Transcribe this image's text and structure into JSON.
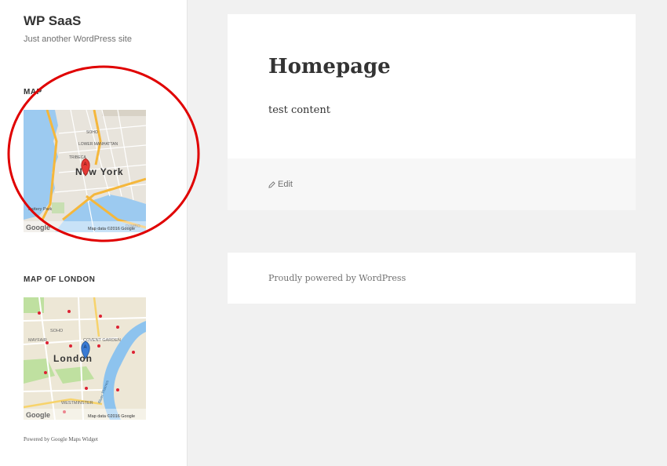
{
  "site": {
    "title": "WP SaaS",
    "tagline": "Just another WordPress site"
  },
  "widgets": [
    {
      "title": "MAP",
      "map": {
        "city_label": "New York",
        "marker_letter": "A",
        "marker_color": "#e53935",
        "attribution": "Map data ©2016 Google",
        "google_logo": "Google",
        "street_labels": [
          "SOHO",
          "LOWER MANHATTAN",
          "TRIBECA",
          "Broadway",
          "FDR Drive",
          "Battery Park",
          "DUMBO",
          "Delancey St",
          "Brooklyn Bridge"
        ]
      }
    },
    {
      "title": "MAP OF LONDON",
      "map": {
        "city_label": "London",
        "marker_letter": "A",
        "marker_color": "#3a7bd5",
        "attribution": "Map data ©2016 Google",
        "google_logo": "Google",
        "area_labels": [
          "SOHO",
          "MAYFAIR",
          "COVENT GARDEN",
          "WESTMINSTER",
          "River Thames"
        ]
      }
    }
  ],
  "sidebar_footer": "Powered by Google Maps Widget",
  "page": {
    "title": "Homepage",
    "content": "test content",
    "edit_label": "Edit",
    "edit_icon": "pencil-icon"
  },
  "footer": {
    "text": "Proudly powered by WordPress"
  },
  "colors": {
    "annotation_circle": "#e00000",
    "background": "#f1f1f1",
    "card": "#ffffff"
  }
}
